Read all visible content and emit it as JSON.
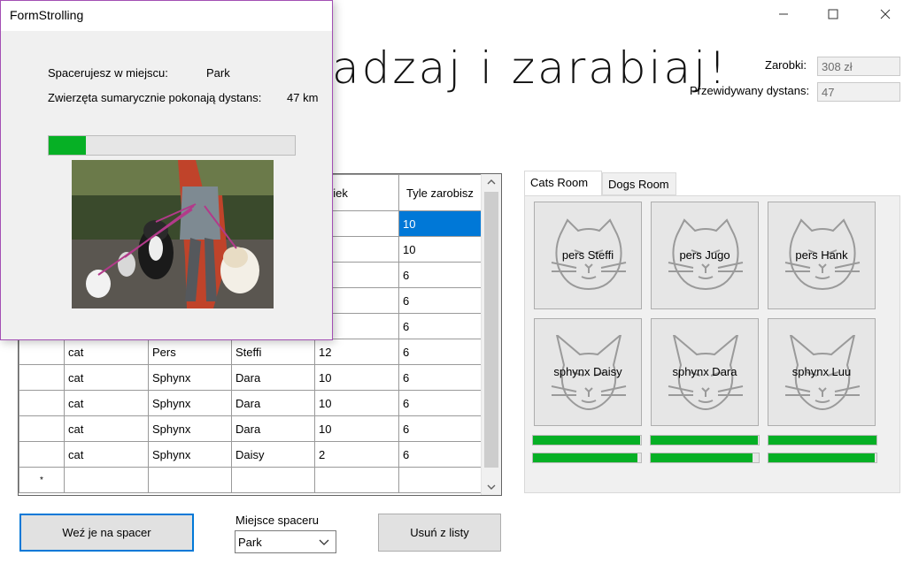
{
  "main_window": {
    "header_text": "adzaj i zarabiaj!",
    "earnings_label": "Zarobki:",
    "earnings_value": "308 zł",
    "distance_label": "Przewidywany dystans:",
    "distance_value": "47"
  },
  "grid": {
    "visible_headers": {
      "age": "Wiek",
      "earn": "Tyle zarobisz"
    },
    "highlighted_rows": [
      {
        "age": "",
        "earn": "10"
      },
      {
        "age": "",
        "earn": "10"
      },
      {
        "age": "",
        "earn": "6"
      },
      {
        "age": "",
        "earn": "6"
      },
      {
        "age": "",
        "earn": "6"
      }
    ],
    "rows": [
      {
        "type": "cat",
        "breed": "Pers",
        "name": "Steffi",
        "age": "12",
        "earn": "6"
      },
      {
        "type": "cat",
        "breed": "Sphynx",
        "name": "Dara",
        "age": "10",
        "earn": "6"
      },
      {
        "type": "cat",
        "breed": "Sphynx",
        "name": "Dara",
        "age": "10",
        "earn": "6"
      },
      {
        "type": "cat",
        "breed": "Sphynx",
        "name": "Dara",
        "age": "10",
        "earn": "6"
      },
      {
        "type": "cat",
        "breed": "Sphynx",
        "name": "Daisy",
        "age": "2",
        "earn": "6"
      }
    ],
    "new_row_marker": "*"
  },
  "controls": {
    "walk_button": "Weź je na spacer",
    "place_label": "Miejsce spaceru",
    "place_selected": "Park",
    "remove_button": "Usuń z listy"
  },
  "tabs": [
    {
      "label": "Cats Room",
      "active": true
    },
    {
      "label": "Dogs Room",
      "active": false
    }
  ],
  "pets": [
    {
      "label": "pers Steffi",
      "icon": "persian-cat-icon"
    },
    {
      "label": "pers Jugo",
      "icon": "persian-cat-icon"
    },
    {
      "label": "pers Hank",
      "icon": "persian-cat-icon"
    },
    {
      "label": "sphynx Daisy",
      "icon": "sphynx-cat-icon"
    },
    {
      "label": "sphynx Dara",
      "icon": "sphynx-cat-icon"
    },
    {
      "label": "sphynx Luu",
      "icon": "sphynx-cat-icon"
    }
  ],
  "progress_bars": [
    {
      "value": 0.99
    },
    {
      "value": 0.99
    },
    {
      "value": 1.0
    },
    {
      "value": 0.97
    },
    {
      "value": 0.94
    },
    {
      "value": 0.98
    }
  ],
  "dialog": {
    "title": "FormStrolling",
    "place_label": "Spacerujesz w miejscu:",
    "place_value": "Park",
    "distance_label": "Zwierzęta sumarycznie pokonają dystans:",
    "distance_value": "47 km",
    "progress": 0.15,
    "photo": "dog-walker-with-dogs-photo"
  },
  "colors": {
    "accent": "#0078d7",
    "progress_green": "#06b025",
    "dialog_border": "#a34fb4"
  }
}
